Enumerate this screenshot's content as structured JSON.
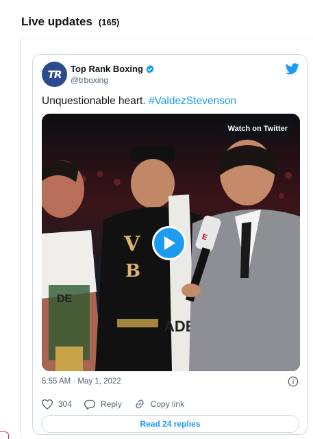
{
  "header": {
    "title": "Live updates",
    "count": "(165)"
  },
  "tweet": {
    "avatar_text": "TR",
    "display_name": "Top Rank Boxing",
    "handle": "@trboxing",
    "text": "Unquestionable heart.",
    "hashtag": "#ValdezStevenson",
    "media": {
      "watch_label": "Watch on Twitter",
      "description": "Video still: boxer and trainer interviewed by ESPN reporter in ring"
    },
    "timestamp": "5:55 AM · May 1, 2022",
    "actions": {
      "likes": "304",
      "reply_label": "Reply",
      "copy_label": "Copy link"
    },
    "read_replies_label": "Read 24 replies"
  },
  "colors": {
    "accent": "#1d9bf0",
    "text": "#0f1419",
    "muted": "#536471",
    "border": "#cfd9de"
  },
  "icons": [
    "verified-badge-icon",
    "twitter-bird-icon",
    "play-icon",
    "info-icon",
    "heart-icon",
    "reply-icon",
    "link-icon"
  ]
}
